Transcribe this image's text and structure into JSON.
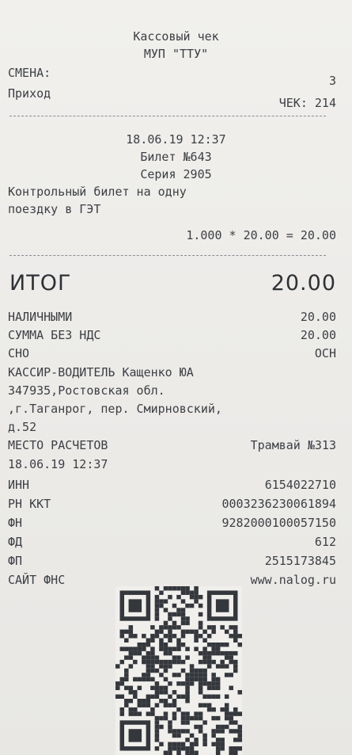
{
  "header": {
    "title": "Кассовый чек",
    "org": "МУП \"ТТУ\"",
    "shift_label": "СМЕНА:",
    "shift_value": "3",
    "type_label": "Приход",
    "check_label": "ЧЕК: 214"
  },
  "ticket": {
    "datetime": "18.06.19 12:37",
    "ticket_no": "Билет №643",
    "series": "Серия 2905",
    "desc_line1": "Контрольный билет на одну",
    "desc_line2": "поездку в ГЭТ",
    "calc": "1.000 * 20.00 = 20.00"
  },
  "totals": {
    "total_label": "ИТОГ",
    "total_value": "20.00",
    "cash_label": "НАЛИЧНЫМИ",
    "cash_value": "20.00",
    "novat_label": "СУММА БЕЗ НДС",
    "novat_value": "20.00",
    "sno_label": "СНО",
    "sno_value": "ОСН"
  },
  "details": {
    "cashier": "КАССИР-ВОДИТЕЛЬ Кащенко ЮА",
    "addr1": "347935,Ростовская обл.",
    "addr2": ",г.Таганрог, пер. Смирновский,",
    "addr3": "д.52",
    "place_label": "МЕСТО РАСЧЕТОВ",
    "place_value": "Трамвай №313",
    "datetime2": "18.06.19 12:37",
    "inn_label": "ИНН",
    "inn_value": "6154022710",
    "rn_label": "РН ККТ",
    "rn_value": "0003236230061894",
    "fn_label": "ФН",
    "fn_value": "9282000100057150",
    "fd_label": "ФД",
    "fd_value": "612",
    "fp_label": "ФП",
    "fp_value": "2515173845",
    "site_label": "САЙТ ФНС",
    "site_value": "www.nalog.ru"
  },
  "colors": {
    "paper": "#eeede9",
    "ink": "#3c3f44"
  }
}
